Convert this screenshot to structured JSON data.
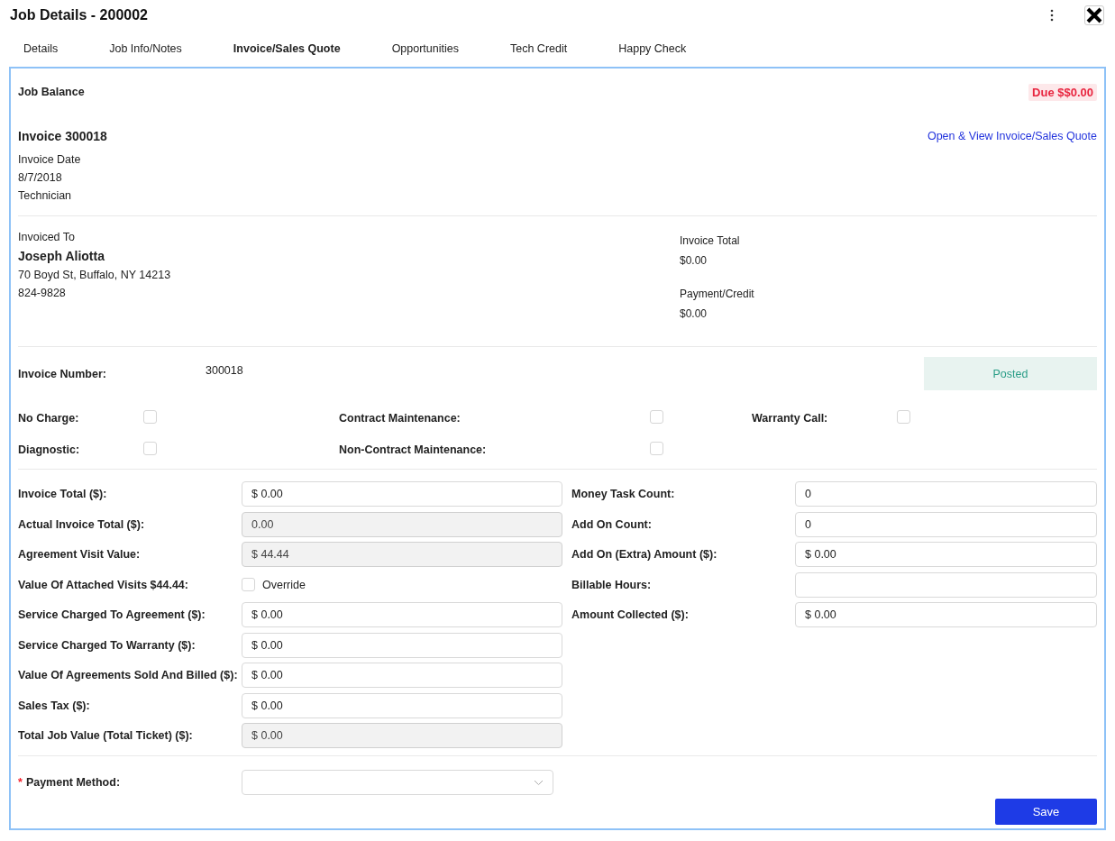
{
  "window": {
    "title": "Job Details - 200002"
  },
  "tabs": [
    {
      "label": "Details",
      "selected": false
    },
    {
      "label": "Job Info/Notes",
      "selected": false
    },
    {
      "label": "Invoice/Sales Quote",
      "selected": true
    },
    {
      "label": "Opportunities",
      "selected": false
    },
    {
      "label": "Tech Credit",
      "selected": false
    },
    {
      "label": "Happy Check",
      "selected": false
    }
  ],
  "balance": {
    "label": "Job Balance",
    "due": "Due $$0.00"
  },
  "invoice": {
    "title": "Invoice 300018",
    "link": "Open & View Invoice/Sales Quote",
    "lines": [
      "Invoice Date",
      "8/7/2018",
      "Technician"
    ]
  },
  "invoiced_to": {
    "label": "Invoiced To",
    "name": "Joseph Aliotta",
    "address": "70 Boyd St, Buffalo, NY 14213",
    "phone": "824-9828"
  },
  "totals": [
    {
      "label": "Invoice Total",
      "value": "$0.00"
    },
    {
      "label": "Payment/Credit",
      "value": "$0.00"
    }
  ],
  "invoice_number": {
    "label": "Invoice Number:",
    "value": "300018",
    "status": "Posted"
  },
  "flags": [
    {
      "label": "No Charge:",
      "checked": false
    },
    {
      "label": "Contract Maintenance:",
      "checked": false
    },
    {
      "label": "Warranty Call:",
      "checked": false
    },
    {
      "label": "Diagnostic:",
      "checked": false
    },
    {
      "label": "Non-Contract Maintenance:",
      "checked": false
    }
  ],
  "left_fields": [
    {
      "label": "Invoice Total ($):",
      "kind": "input",
      "value": "$ 0.00",
      "disabled": false
    },
    {
      "label": "Actual Invoice Total ($):",
      "kind": "input",
      "value": "0.00",
      "disabled": true
    },
    {
      "label": "Agreement Visit Value:",
      "kind": "input",
      "value": "$ 44.44",
      "disabled": true
    },
    {
      "label": "Value Of Attached Visits $44.44:",
      "kind": "checkbox",
      "value": "Override",
      "checked": false
    },
    {
      "label": "Service Charged To Agreement ($):",
      "kind": "input",
      "value": "$ 0.00",
      "disabled": false
    },
    {
      "label": "Service Charged To Warranty ($):",
      "kind": "input",
      "value": "$ 0.00",
      "disabled": false
    },
    {
      "label": "Value Of Agreements Sold And Billed ($):",
      "kind": "input",
      "value": "$ 0.00",
      "disabled": false
    },
    {
      "label": "Sales Tax ($):",
      "kind": "input",
      "value": "$ 0.00",
      "disabled": false
    },
    {
      "label": "Total Job Value (Total Ticket) ($):",
      "kind": "input",
      "value": "$ 0.00",
      "disabled": true
    }
  ],
  "right_fields": [
    {
      "label": "Money Task Count:",
      "kind": "input",
      "value": "0",
      "disabled": false
    },
    {
      "label": "Add On Count:",
      "kind": "input",
      "value": "0",
      "disabled": false
    },
    {
      "label": "Add On (Extra) Amount ($):",
      "kind": "input",
      "value": "$ 0.00",
      "disabled": false
    },
    {
      "label": "Billable Hours:",
      "kind": "input",
      "disabled": false
    },
    {
      "label": "Amount Collected ($):",
      "kind": "input",
      "value": "$ 0.00",
      "disabled": false
    }
  ],
  "payment_method": {
    "label": "Payment Method:",
    "required_mark": "*"
  },
  "save_button": "Save"
}
